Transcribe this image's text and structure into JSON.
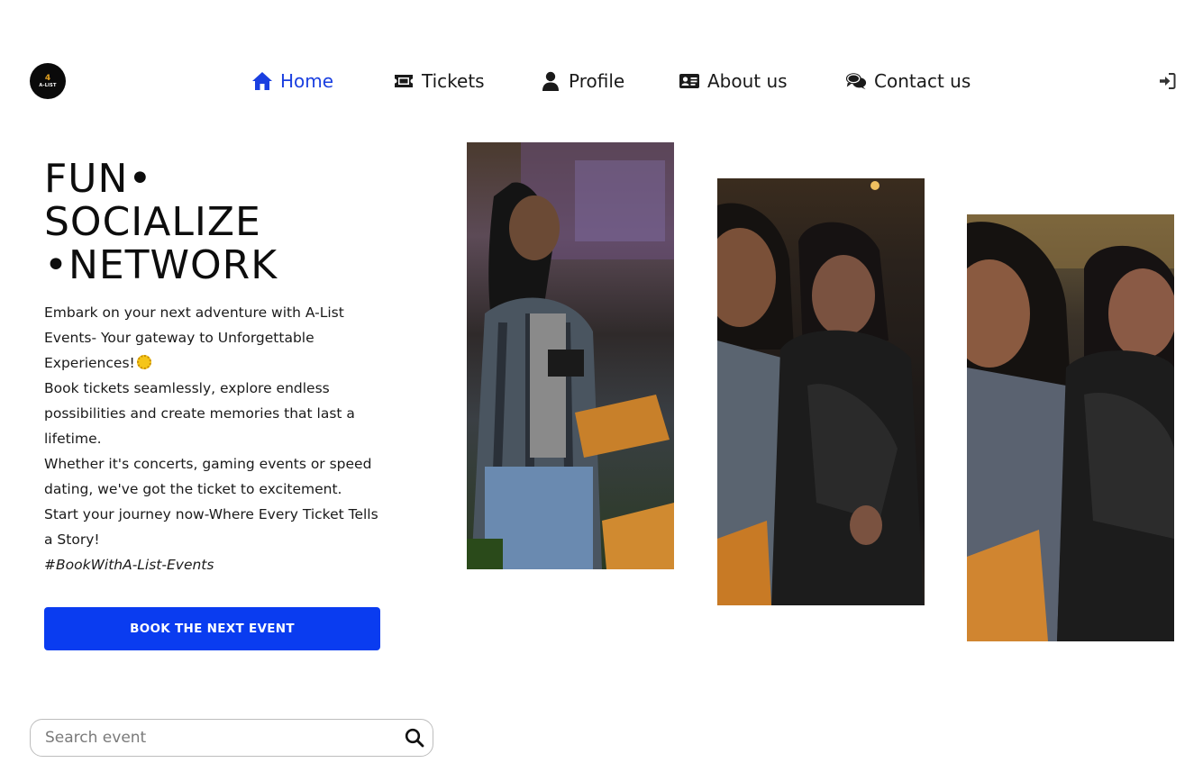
{
  "logo": {
    "line1": "4",
    "line2": "A-LIST"
  },
  "nav": {
    "items": [
      {
        "label": "Home",
        "icon": "home-icon",
        "active": true
      },
      {
        "label": "Tickets",
        "icon": "ticket-icon",
        "active": false
      },
      {
        "label": "Profile",
        "icon": "user-icon",
        "active": false
      },
      {
        "label": "About us",
        "icon": "id-card-icon",
        "active": false
      },
      {
        "label": "Contact us",
        "icon": "comments-icon",
        "active": false
      }
    ],
    "login_icon": "sign-in-icon"
  },
  "hero": {
    "title_lines": [
      "FUN•",
      "SOCIALIZE",
      "•NETWORK"
    ],
    "paragraphs": [
      "Embark on your next adventure with A-List Events- Your gateway to Unforgettable Experiences!",
      "Book tickets seamlessly, explore endless possibilities and create memories that last a lifetime.",
      "Whether it's concerts, gaming events or speed dating, we've got the ticket to excitement.",
      "Start your journey now-Where Every Ticket Tells a Story!"
    ],
    "hashtag": "#BookWithA-List-Events",
    "cta_label": "BOOK THE NEXT EVENT"
  },
  "search": {
    "placeholder": "Search event",
    "icon": "search-icon"
  },
  "colors": {
    "accent": "#0a3cf0",
    "nav_active": "#1a3fe0"
  }
}
